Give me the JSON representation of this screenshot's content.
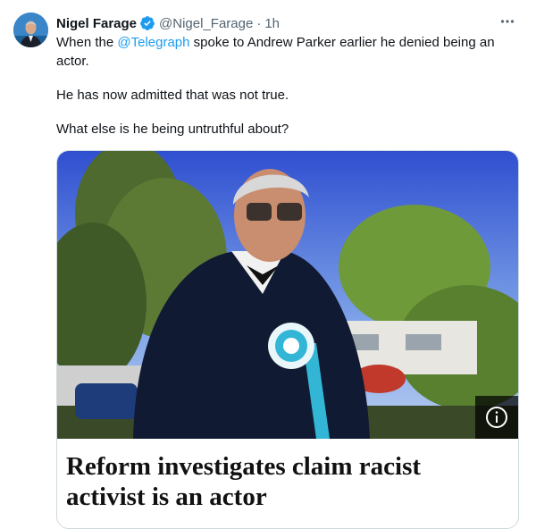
{
  "author": {
    "display_name": "Nigel Farage",
    "handle": "@Nigel_Farage",
    "separator": "·",
    "time": "1h",
    "verified": true,
    "avatar_icon": "user-avatar-photo"
  },
  "tweet": {
    "line1_before": "When the ",
    "mention": "@Telegraph",
    "line1_after": " spoke to Andrew Parker earlier he denied being an actor.",
    "paragraph2": "He has now admitted that was not true.",
    "paragraph3": "What else is he being untruthful about?"
  },
  "card": {
    "headline": "Reform investigates claim racist activist is an actor",
    "info_icon": "info-icon"
  },
  "colors": {
    "accent": "#1d9bf0",
    "secondary_text": "#536471",
    "rosette": "#33b6d6"
  }
}
